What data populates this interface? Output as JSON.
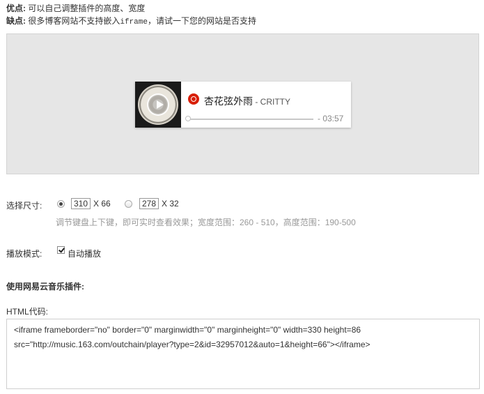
{
  "info": {
    "pros_label": "优点:",
    "pros_text": " 可以自己调整插件的高度、宽度",
    "cons_label": "缺点:",
    "cons_text_1": " 很多博客网站不支持嵌入",
    "cons_mono": "iframe",
    "cons_text_2": "，请试一下您的网站是否支持"
  },
  "player": {
    "song": "杏花弦外雨",
    "artist": " - CRITTY",
    "time": "- 03:57",
    "progress": 0,
    "brand_color": "#d81e06"
  },
  "size": {
    "label": "选择尺寸:",
    "option1_value": "310",
    "option1_times": "X 66",
    "option2_value": "278",
    "option2_times": "X 32",
    "selected": "option1",
    "hint": "调节键盘上下键，即可实时查看效果；宽度范围：260 - 510，高度范围：190-500"
  },
  "mode": {
    "label": "播放模式:",
    "autoplay_label": "自动播放",
    "autoplay_checked": true
  },
  "usage": {
    "title": "使用网易云音乐插件:",
    "html_label": "HTML代码:",
    "code": "<iframe frameborder=\"no\" border=\"0\" marginwidth=\"0\" marginheight=\"0\" width=330 height=86 src=\"http://music.163.com/outchain/player?type=2&id=32957012&auto=1&height=66\"></iframe>"
  }
}
